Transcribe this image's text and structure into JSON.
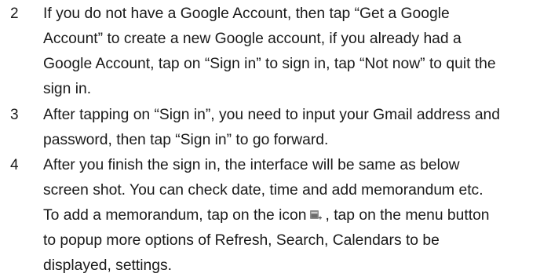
{
  "steps": [
    {
      "number": "2",
      "lines": [
        "If you do not have a Google Account, then tap “Get a Google",
        "Account” to create a new Google account, if you already had a",
        "Google Account, tap on “Sign in” to sign in, tap “Not now” to quit the",
        "sign in."
      ]
    },
    {
      "number": "3",
      "lines": [
        "After tapping on “Sign in”, you need to input your Gmail address and",
        "password, then tap “Sign in” to go forward."
      ]
    },
    {
      "number": "4",
      "lines": [
        "After you finish the sign in, the interface will be same as below",
        "screen shot. You can check date, time and add memorandum etc.",
        "To add a memorandum, tap on the icon",
        "to popup more options of Refresh, Search, Calendars to be",
        "displayed, settings."
      ],
      "line3_after_icon": ", tap on the menu button"
    }
  ],
  "icons": {
    "add_event": "add-event-icon"
  }
}
